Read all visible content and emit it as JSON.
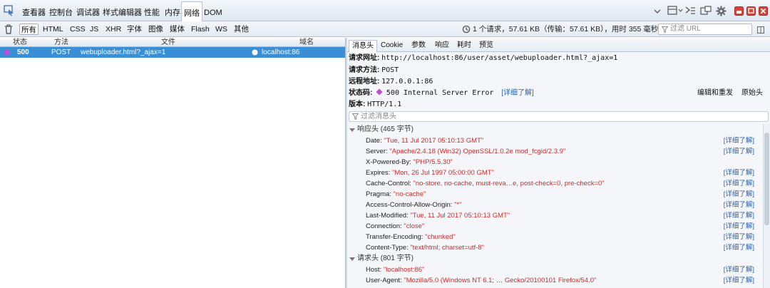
{
  "toolbar": {
    "tabs": [
      "查看器",
      "控制台",
      "调试器",
      "样式编辑器",
      "性能",
      "内存",
      "网络",
      "DOM"
    ],
    "active_tab": "网络"
  },
  "filter": {
    "buttons": [
      "所有",
      "HTML",
      "CSS",
      "JS",
      "XHR",
      "字体",
      "图像",
      "媒体",
      "Flash",
      "WS",
      "其他"
    ],
    "active": "所有",
    "summary": "1 个请求，57.61 KB（传输：57.61 KB），用时 355 毫秒",
    "url_placeholder": "过滤 URL"
  },
  "list": {
    "columns": {
      "status": "状态",
      "method": "方法",
      "file": "文件",
      "domain": "域名"
    },
    "request": {
      "status": "500",
      "method": "POST",
      "file": "webuploader.html?_ajax=1",
      "domain": "localhost:86"
    }
  },
  "details": {
    "tabs": [
      "消息头",
      "Cookie",
      "参数",
      "响应",
      "耗时",
      "预览"
    ],
    "active_tab": "消息头",
    "request_url_label": "请求网址:",
    "request_url": "http://localhost:86/user/asset/webuploader.html?_ajax=1",
    "method_label": "请求方法:",
    "method": "POST",
    "remote_label": "远程地址:",
    "remote": "127.0.0.1:86",
    "status_label": "状态码:",
    "status": "500 Internal Server Error",
    "detail_link": "[详细了解]",
    "version_label": "版本:",
    "version": "HTTP/1.1",
    "edit_resend": "编辑和重发",
    "raw_headers": "原始头",
    "filter_placeholder": "过滤消息头",
    "response_section": "响应头 (465 字节)",
    "request_section": "请求头 (801 字节)",
    "detail_text": "[详细了解]",
    "response_headers": [
      {
        "name": "Date:",
        "value": "\"Tue, 11 Jul 2017 05:10:13 GMT\"",
        "link": true
      },
      {
        "name": "Server:",
        "value": "\"Apache/2.4.18 (Win32) OpenSSL/1.0.2e mod_fcgid/2.3.9\"",
        "link": true
      },
      {
        "name": "X-Powered-By:",
        "value": "\"PHP/5.5.30\"",
        "link": false
      },
      {
        "name": "Expires:",
        "value": "\"Mon, 26 Jul 1997 05:00:00 GMT\"",
        "link": true
      },
      {
        "name": "Cache-Control:",
        "value": "\"no-store, no-cache, must-reva…e, post-check=0, pre-check=0\"",
        "link": true
      },
      {
        "name": "Pragma:",
        "value": "\"no-cache\"",
        "link": true
      },
      {
        "name": "Access-Control-Allow-Origin:",
        "value": "\"*\"",
        "link": true
      },
      {
        "name": "Last-Modified:",
        "value": "\"Tue, 11 Jul 2017 05:10:13 GMT\"",
        "link": true
      },
      {
        "name": "Connection:",
        "value": "\"close\"",
        "link": true
      },
      {
        "name": "Transfer-Encoding:",
        "value": "\"chunked\"",
        "link": true
      },
      {
        "name": "Content-Type:",
        "value": "\"text/html; charset=utf-8\"",
        "link": true
      }
    ],
    "request_headers": [
      {
        "name": "Host:",
        "value": "\"localhost:86\"",
        "link": true
      },
      {
        "name": "User-Agent:",
        "value": "\"Mozilla/5.0 (Windows NT 6.1; … Gecko/20100101 Firefox/54.0\"",
        "link": true
      }
    ]
  },
  "colors": {
    "accent": "#3a8ed6",
    "error_value": "#d12a2a",
    "status_diamond": "#c24bd8",
    "link": "#2a62b0"
  }
}
